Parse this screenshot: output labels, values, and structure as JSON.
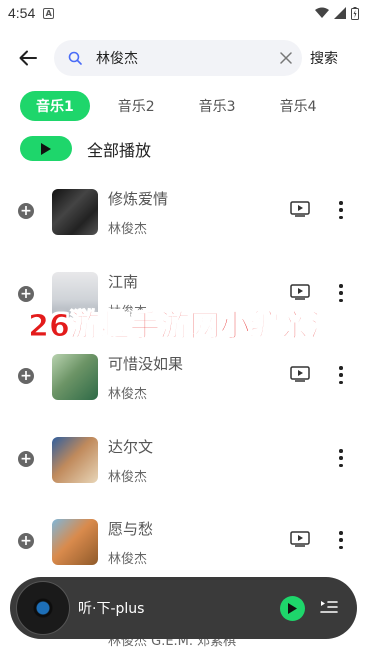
{
  "status_bar": {
    "time": "4:54",
    "notif_letter": "A"
  },
  "search": {
    "query": "林俊杰",
    "button_label": "搜索"
  },
  "tabs": [
    {
      "label": "音乐1",
      "active": true
    },
    {
      "label": "音乐2",
      "active": false
    },
    {
      "label": "音乐3",
      "active": false
    },
    {
      "label": "音乐4",
      "active": false
    }
  ],
  "play_all": {
    "label": "全部播放"
  },
  "songs": [
    {
      "title": "修炼爱情",
      "artist": "林俊杰",
      "has_mv": true
    },
    {
      "title": "江南",
      "artist": "林俊杰",
      "has_mv": true
    },
    {
      "title": "可惜没如果",
      "artist": "林俊杰",
      "has_mv": true
    },
    {
      "title": "达尔文",
      "artist": "林俊杰",
      "has_mv": false
    },
    {
      "title": "愿与愁",
      "artist": "林俊杰",
      "has_mv": true
    }
  ],
  "partial_artist": "林俊杰 G.E.M. 邓紫棋",
  "watermark": "26游趣手游网小编亲测",
  "player": {
    "title": "听·下-plus"
  },
  "colors": {
    "accent": "#1ed66b",
    "watermark": "#e31b1b",
    "player_bg": "#3a3a3a"
  }
}
